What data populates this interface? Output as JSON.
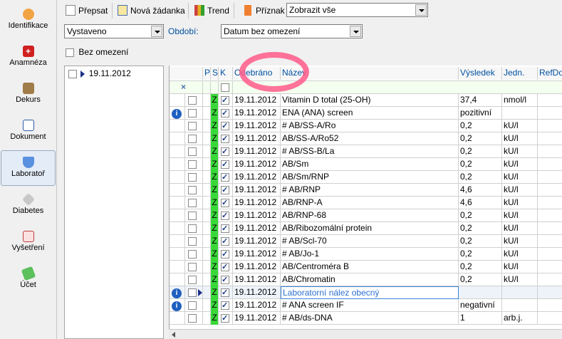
{
  "nav": [
    {
      "label": "Identifikace",
      "icon": "person-icon",
      "color": "#e07020"
    },
    {
      "label": "Anamnéza",
      "icon": "medical-cross-icon",
      "color": "#d02020"
    },
    {
      "label": "Dekurs",
      "icon": "briefcase-icon",
      "color": "#8a6a3a"
    },
    {
      "label": "Dokument",
      "icon": "document-icon",
      "color": "#2a5ca8"
    },
    {
      "label": "Laboratoř",
      "icon": "flask-icon",
      "color": "#3070d0"
    },
    {
      "label": "Diabetes",
      "icon": "diabetes-icon",
      "color": "#777777"
    },
    {
      "label": "Vyšetření",
      "icon": "chart-icon",
      "color": "#c04040"
    },
    {
      "label": "Účet",
      "icon": "money-icon",
      "color": "#40a040"
    }
  ],
  "toolbar": {
    "prepsat": "Přepsat",
    "nova_zadanka": "Nová žádanka",
    "trend": "Trend",
    "priznak": "Příznak",
    "filter_value": "Zobrazit vše"
  },
  "filters": {
    "status_value": "Vystaveno",
    "obdobi_label": "Období:",
    "obdobi_value": "Datum bez omezení",
    "bez_omezeni_label": "Bez omezení"
  },
  "dates": [
    "19.11.2012"
  ],
  "columns": {
    "p": "P",
    "s": "S",
    "k": "K",
    "odebrano": "Odebráno",
    "nazev": "Název",
    "vysledek": "Výsledek",
    "jedn": "Jedn.",
    "refdo": "RefDo"
  },
  "rows": [
    {
      "info": false,
      "z": "Z",
      "date": "19.11.2012",
      "name": "Vitamin D total (25-OH)",
      "result": "37,4",
      "unit": "nmol/l"
    },
    {
      "info": true,
      "z": "Z",
      "date": "19.11.2012",
      "name": "ENA (ANA) screen",
      "result": "pozitivní",
      "unit": ""
    },
    {
      "info": false,
      "z": "Z",
      "date": "19.11.2012",
      "name": "# AB/SS-A/Ro",
      "result": "0,2",
      "unit": "kU/l"
    },
    {
      "info": false,
      "z": "Z",
      "date": "19.11.2012",
      "name": "AB/SS-A/Ro52",
      "result": "0,2",
      "unit": "kU/l"
    },
    {
      "info": false,
      "z": "Z",
      "date": "19.11.2012",
      "name": "# AB/SS-B/La",
      "result": "0,2",
      "unit": "kU/l"
    },
    {
      "info": false,
      "z": "Z",
      "date": "19.11.2012",
      "name": "AB/Sm",
      "result": "0,2",
      "unit": "kU/l"
    },
    {
      "info": false,
      "z": "Z",
      "date": "19.11.2012",
      "name": "AB/Sm/RNP",
      "result": "0,2",
      "unit": "kU/l"
    },
    {
      "info": false,
      "z": "Z",
      "date": "19.11.2012",
      "name": "# AB/RNP",
      "result": "4,6",
      "unit": "kU/l"
    },
    {
      "info": false,
      "z": "Z",
      "date": "19.11.2012",
      "name": "AB/RNP-A",
      "result": "4,6",
      "unit": "kU/l"
    },
    {
      "info": false,
      "z": "Z",
      "date": "19.11.2012",
      "name": "AB/RNP-68",
      "result": "0,2",
      "unit": "kU/l"
    },
    {
      "info": false,
      "z": "Z",
      "date": "19.11.2012",
      "name": "AB/Ribozomální protein",
      "result": "0,2",
      "unit": "kU/l"
    },
    {
      "info": false,
      "z": "Z",
      "date": "19.11.2012",
      "name": "# AB/Scl-70",
      "result": "0,2",
      "unit": "kU/l"
    },
    {
      "info": false,
      "z": "Z",
      "date": "19.11.2012",
      "name": "# AB/Jo-1",
      "result": "0,2",
      "unit": "kU/l"
    },
    {
      "info": false,
      "z": "Z",
      "date": "19.11.2012",
      "name": "AB/Centroméra B",
      "result": "0,2",
      "unit": "kU/l"
    },
    {
      "info": false,
      "z": "Z",
      "date": "19.11.2012",
      "name": "AB/Chromatin",
      "result": "0,2",
      "unit": "kU/l"
    },
    {
      "info": true,
      "z": "Z",
      "date": "19.11.2012",
      "name": "Laboratorní nález obecný",
      "result": "",
      "unit": "",
      "selected": true
    },
    {
      "info": true,
      "z": "Z",
      "date": "19.11.2012",
      "name": "# ANA screen IF",
      "result": "negativní",
      "unit": ""
    },
    {
      "info": false,
      "z": "Z",
      "date": "19.11.2012",
      "name": "# AB/ds-DNA",
      "result": "1",
      "unit": "arb.j."
    }
  ]
}
